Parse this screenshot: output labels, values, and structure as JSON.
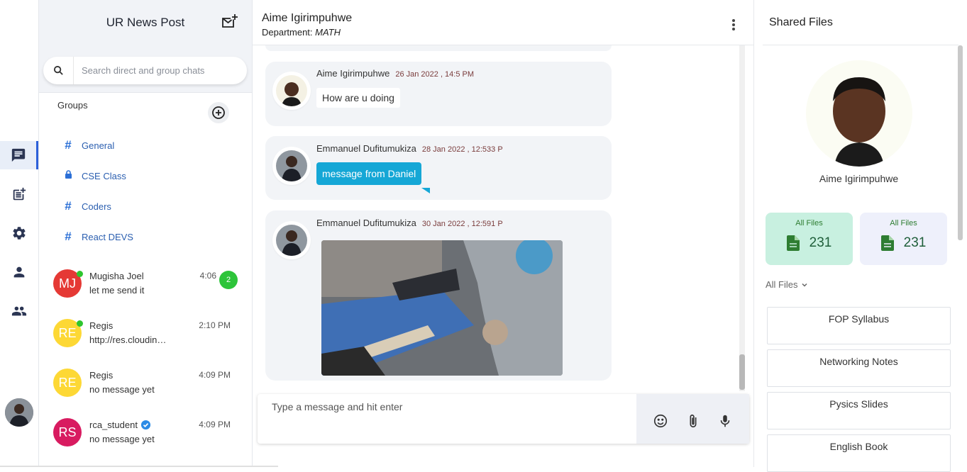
{
  "app": {
    "title": "UR News Post"
  },
  "search": {
    "placeholder": "Search direct and group chats"
  },
  "groups": {
    "label": "Groups",
    "items": [
      {
        "label": "General",
        "icon": "hash-icon"
      },
      {
        "label": "CSE Class",
        "icon": "lock-icon"
      },
      {
        "label": "Coders",
        "icon": "hash-icon"
      },
      {
        "label": "React DEVS",
        "icon": "hash-icon"
      }
    ]
  },
  "chats": [
    {
      "initials": "MJ",
      "name": "Mugisha Joel",
      "preview": "let me send it",
      "time": "4:06",
      "unread": "2",
      "color": "#e53935",
      "online": true
    },
    {
      "initials": "RE",
      "name": "Regis",
      "preview": "http://res.cloudinary.com",
      "time": "2:10 PM",
      "color": "#fdd835",
      "online": true
    },
    {
      "initials": "RE",
      "name": "Regis",
      "preview": "no message yet",
      "time": "4:09 PM",
      "color": "#fdd835",
      "online": false
    },
    {
      "initials": "RS",
      "name": "rca_student",
      "preview": "no message yet",
      "time": "4:09 PM",
      "color": "#d81b60",
      "online": false,
      "verified": true
    }
  ],
  "header": {
    "name": "Aime Igirimpuhwe",
    "dept_label": "Department:",
    "dept_value": "MATH"
  },
  "messages": [
    {
      "author": "Aime Igirimpuhwe",
      "time": "26 Jan 2022 , 14:5 PM",
      "text": "How are u doing"
    },
    {
      "author": "Emmanuel Dufitumukiza",
      "time": "28 Jan 2022 , 12:533 P",
      "text": "message from Daniel"
    },
    {
      "author": "Emmanuel Dufitumukiza",
      "time": "30 Jan 2022 , 12:591 P",
      "image": "photo of person holding breadboard electronics"
    }
  ],
  "composer": {
    "placeholder": "Type a message and hit enter"
  },
  "shared": {
    "title": "Shared Files",
    "profile_name": "Aime Igirimpuhwe",
    "stats": [
      {
        "label": "All Files",
        "value": "231",
        "bg": "#c8f0e0"
      },
      {
        "label": "All Files",
        "value": "231",
        "bg": "#eef0fb"
      }
    ],
    "filter": "All Files",
    "files": [
      "FOP Syllabus",
      "Networking Notes",
      "Pysics Slides",
      "English Book"
    ]
  },
  "colors": {
    "accent": "#2b5fd9",
    "bubble": "#15a7d6",
    "online": "#2ec52e"
  }
}
